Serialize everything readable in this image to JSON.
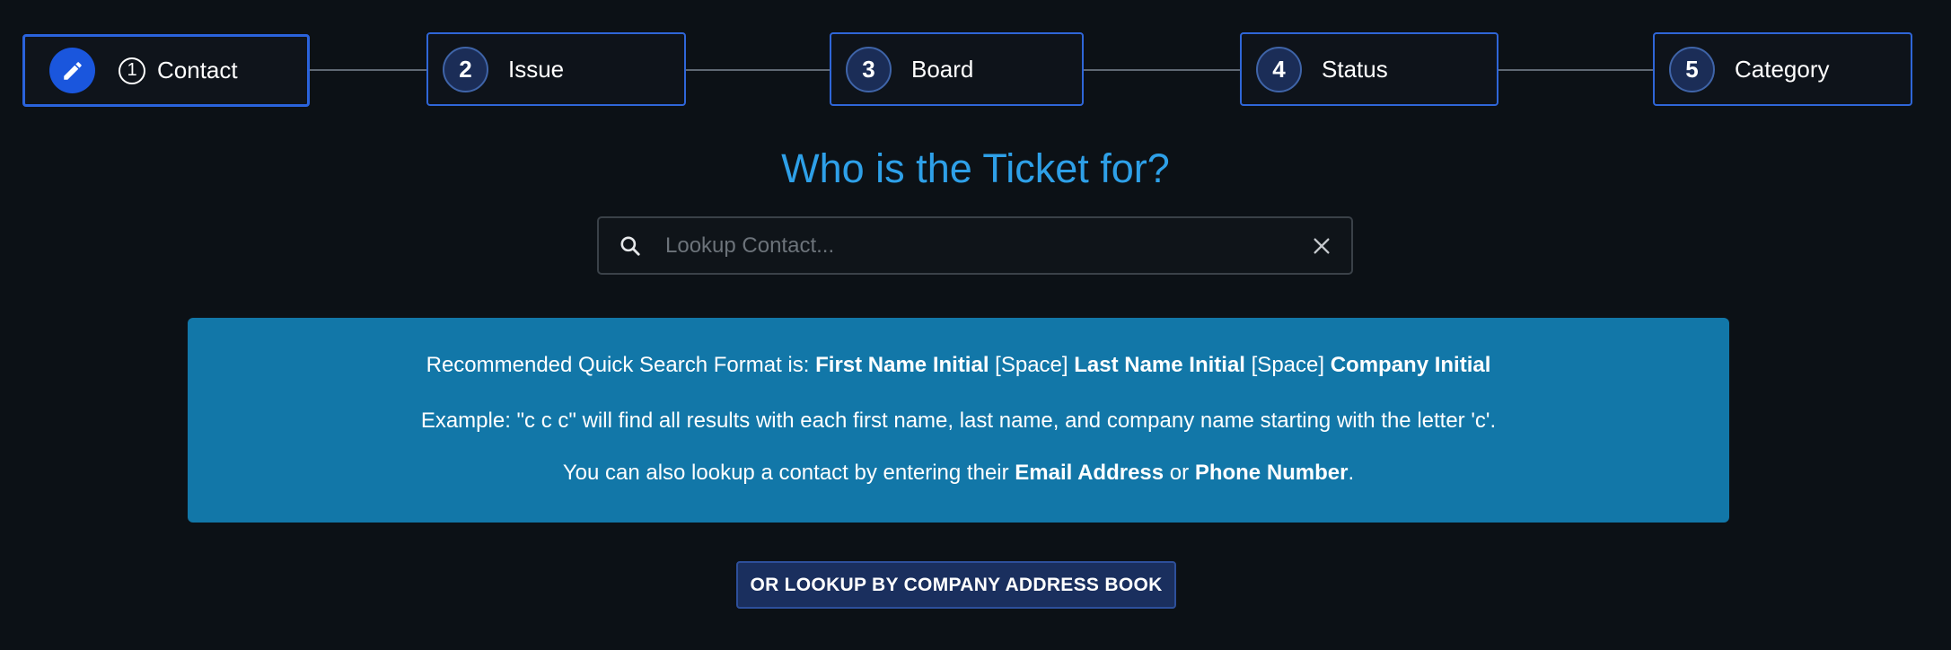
{
  "stepper": {
    "steps": [
      {
        "number": "1",
        "label": "Contact",
        "state": "active"
      },
      {
        "number": "2",
        "label": "Issue",
        "state": "pending"
      },
      {
        "number": "3",
        "label": "Board",
        "state": "pending"
      },
      {
        "number": "4",
        "label": "Status",
        "state": "pending"
      },
      {
        "number": "5",
        "label": "Category",
        "state": "pending"
      }
    ]
  },
  "heading": "Who is the Ticket for?",
  "search": {
    "placeholder": "Lookup Contact...",
    "value": ""
  },
  "info": {
    "line1": {
      "prefix": "Recommended Quick Search Format is: ",
      "part1": "First Name Initial",
      "sep1": " [Space] ",
      "part2": "Last Name Initial",
      "sep2": " [Space] ",
      "part3": "Company Initial"
    },
    "line2": "Example: \"c c c\" will find all results with each first name, last name, and company name starting with the letter 'c'.",
    "line3": {
      "prefix": "You can also lookup a contact by entering their ",
      "email": "Email Address",
      "or": " or ",
      "phone": "Phone Number",
      "suffix": "."
    }
  },
  "address_book_button": "OR LOOKUP BY COMPANY ADDRESS BOOK",
  "colors": {
    "background": "#0c1116",
    "accent": "#2ea0e8",
    "step_border": "#2f66d8",
    "info_box": "#1277a8",
    "button": "#1a2f5e"
  },
  "icons": {
    "active_step": "pencil-icon",
    "search": "search-icon",
    "clear": "close-icon"
  }
}
